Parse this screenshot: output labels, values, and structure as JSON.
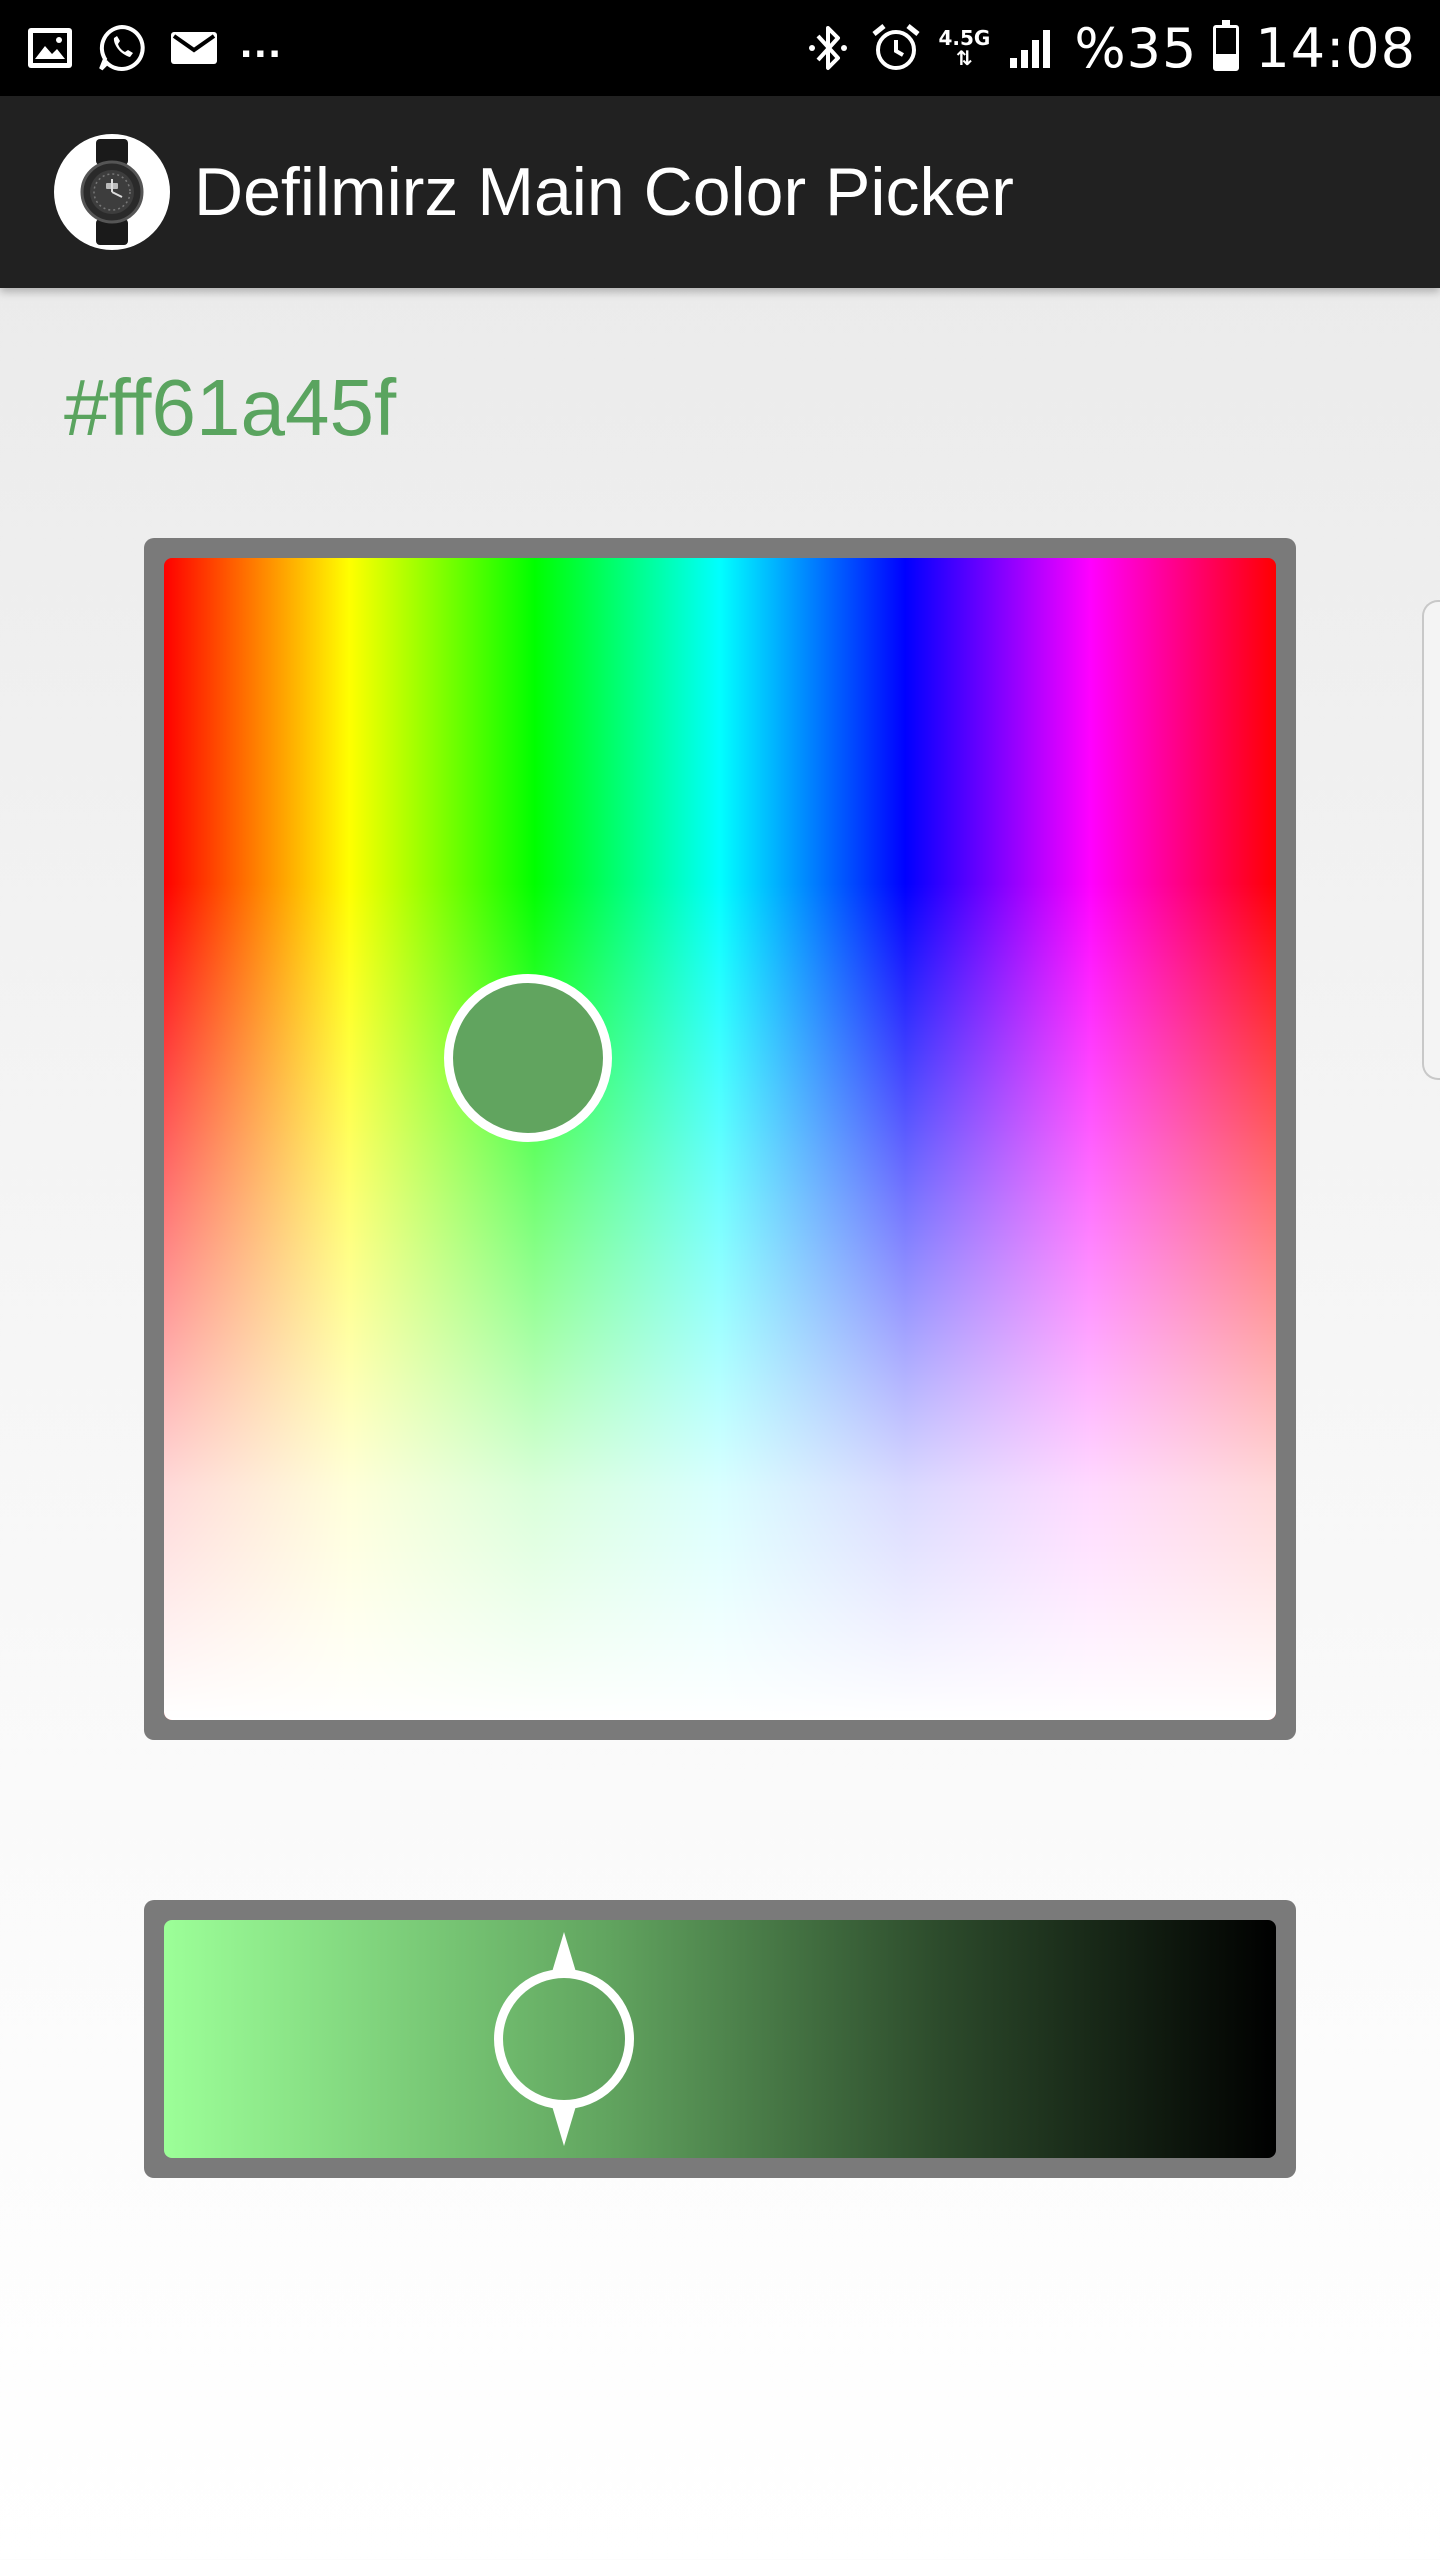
{
  "status_bar": {
    "left_icons": [
      "gallery-icon",
      "whatsapp-icon",
      "mail-icon"
    ],
    "overflow": "...",
    "right_icons": [
      "bluetooth-icon",
      "alarm-icon",
      "network-4-5g-icon",
      "signal-icon",
      "battery-icon"
    ],
    "network": "4.5G",
    "battery_level": "%35",
    "time": "14:08"
  },
  "app_bar": {
    "logo_icon": "smartwatch-icon",
    "title": "Defilmirz Main Color Picker"
  },
  "picker": {
    "hex_value": "#ff61a45f",
    "current_color": "#61a45f",
    "hue_cursor": {
      "hue_degrees": 118,
      "saturation": 0.57
    },
    "value_slider": {
      "start_color": "#9cff98",
      "end_color": "#000000",
      "value": 0.36
    }
  }
}
